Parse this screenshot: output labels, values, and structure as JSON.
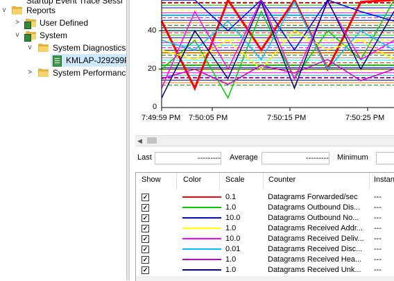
{
  "tree": {
    "partial_item": "Startup Event Trace Sessi",
    "items": [
      {
        "label": "Reports",
        "chevron": "v",
        "indent": 0
      },
      {
        "label": "User Defined",
        "chevron": ">",
        "indent": 1
      },
      {
        "label": "System",
        "chevron": "v",
        "indent": 1
      },
      {
        "label": "System Diagnostics",
        "chevron": "v",
        "indent": 2
      },
      {
        "label": "KMLAP-J29299P",
        "chevron": "",
        "indent": 3,
        "selected": true
      },
      {
        "label": "System Performanc",
        "chevron": ">",
        "indent": 2
      }
    ]
  },
  "chart": {
    "y_ticks": [
      "40",
      "20",
      "0"
    ],
    "x_ticks": [
      "7:49:59 PM",
      "7:50:05 PM",
      "7:50:15 PM",
      "7:50:25 PM"
    ]
  },
  "chart_data": {
    "type": "line",
    "ylim": [
      0,
      100
    ],
    "x": [
      "7:49:59 PM",
      "7:50:05 PM",
      "7:50:15 PM",
      "7:50:25 PM"
    ],
    "series": [
      {
        "name": "Datagrams Forwarded/sec",
        "color": "#ff0000",
        "values": [
          45,
          10,
          60,
          30,
          80,
          20,
          55,
          90
        ]
      },
      {
        "name": "Datagrams Outbound Dis...",
        "color": "#00cc00",
        "values": [
          20,
          35,
          5,
          50,
          15,
          40,
          25,
          60
        ]
      },
      {
        "name": "Datagrams Outbound No...",
        "color": "#0000ff",
        "values": [
          60,
          75,
          40,
          65,
          30,
          70,
          50,
          45
        ]
      },
      {
        "name": "Datagrams Received Addr...",
        "color": "#ffff00",
        "values": [
          30,
          25,
          35,
          20,
          40,
          30,
          35,
          25
        ]
      },
      {
        "name": "Datagrams Received Deliv...",
        "color": "#ff00ff",
        "values": [
          10,
          50,
          20,
          70,
          15,
          55,
          25,
          35
        ]
      },
      {
        "name": "Datagrams Received Disc...",
        "color": "#00c0ff",
        "values": [
          35,
          30,
          45,
          25,
          55,
          20,
          40,
          30
        ]
      },
      {
        "name": "Datagrams Received Hea...",
        "color": "#cc00cc",
        "values": [
          15,
          20,
          12,
          22,
          18,
          25,
          14,
          20
        ]
      },
      {
        "name": "Datagrams Received Unk...",
        "color": "#000080",
        "values": [
          5,
          40,
          15,
          55,
          10,
          65,
          20,
          50
        ]
      }
    ]
  },
  "stats": {
    "last_label": "Last",
    "last_value": "---------",
    "average_label": "Average",
    "average_value": "---------",
    "minimum_label": "Minimum"
  },
  "grid": {
    "headers": [
      "Show",
      "Color",
      "Scale",
      "Counter",
      "Instan"
    ],
    "rows": [
      {
        "checked": "✓",
        "color": "#ff0000",
        "scale": "0.1",
        "counter": "Datagrams Forwarded/sec",
        "instance": "---"
      },
      {
        "checked": "✓",
        "color": "#00cc00",
        "scale": "1.0",
        "counter": "Datagrams Outbound Dis...",
        "instance": "---"
      },
      {
        "checked": "✓",
        "color": "#0000ff",
        "scale": "10.0",
        "counter": "Datagrams Outbound No...",
        "instance": "---"
      },
      {
        "checked": "✓",
        "color": "#ffff00",
        "scale": "1.0",
        "counter": "Datagrams Received Addr...",
        "instance": "---"
      },
      {
        "checked": "✓",
        "color": "#ff00ff",
        "scale": "10.0",
        "counter": "Datagrams Received Deliv...",
        "instance": "---"
      },
      {
        "checked": "✓",
        "color": "#00c0ff",
        "scale": "0.01",
        "counter": "Datagrams Received Disc...",
        "instance": "---"
      },
      {
        "checked": "✓",
        "color": "#cc00cc",
        "scale": "1.0",
        "counter": "Datagrams Received Hea...",
        "instance": "---"
      },
      {
        "checked": "✓",
        "color": "#000080",
        "scale": "1.0",
        "counter": "Datagrams Received Unk...",
        "instance": "---"
      }
    ]
  }
}
